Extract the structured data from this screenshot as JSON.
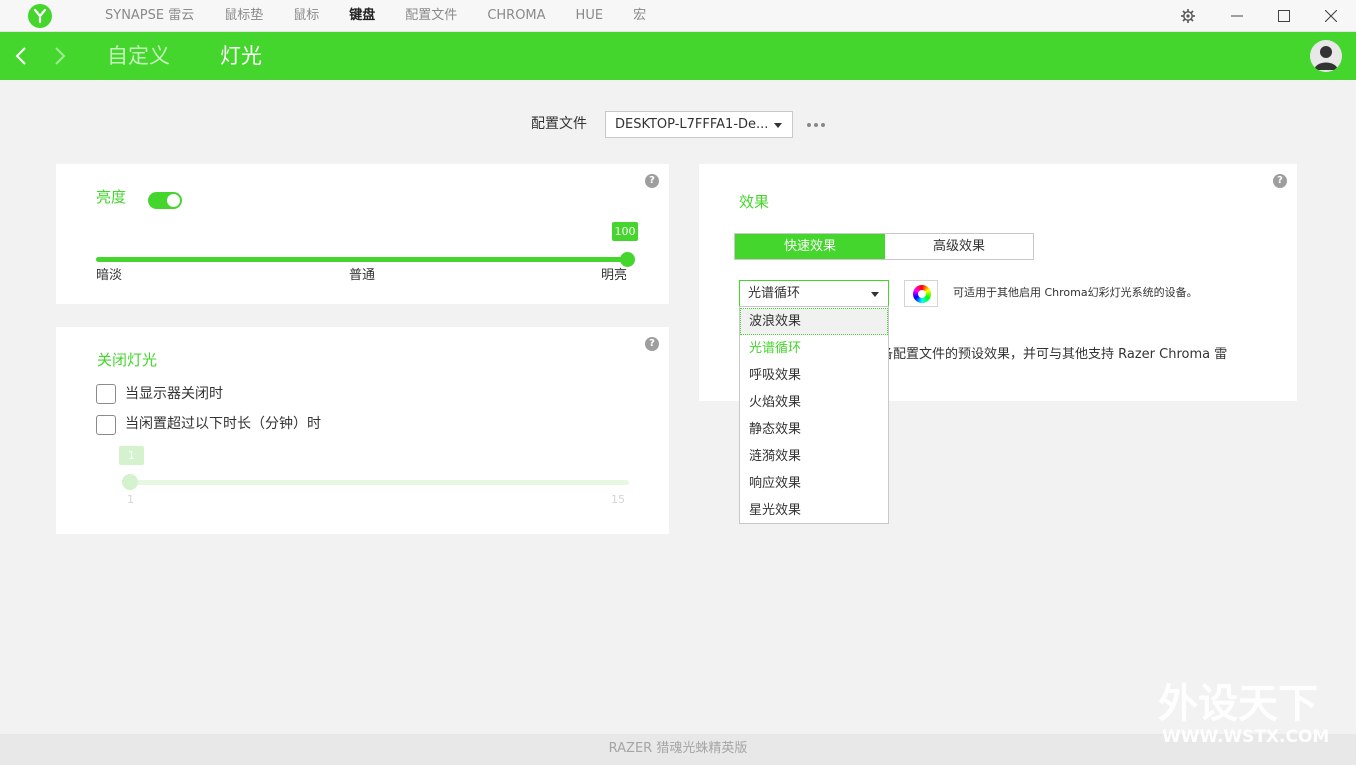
{
  "titlebar": {
    "tabs": [
      {
        "label": "SYNAPSE 雷云",
        "active": false
      },
      {
        "label": "鼠标垫",
        "active": false
      },
      {
        "label": "鼠标",
        "active": false
      },
      {
        "label": "键盘",
        "active": true
      },
      {
        "label": "配置文件",
        "active": false
      },
      {
        "label": "CHROMA",
        "active": false
      },
      {
        "label": "HUE",
        "active": false
      },
      {
        "label": "宏",
        "active": false
      }
    ]
  },
  "header": {
    "breadcrumbs": [
      "自定义",
      "灯光"
    ],
    "active_crumb": "灯光"
  },
  "profile": {
    "label": "配置文件",
    "value": "DESKTOP-L7FFFA1-De..."
  },
  "brightness": {
    "title": "亮度",
    "enabled": true,
    "value": "100",
    "level": 1.0,
    "labels": [
      "暗淡",
      "普通",
      "明亮"
    ]
  },
  "lights_off": {
    "title": "关闭灯光",
    "options": [
      {
        "label": "当显示器关闭时",
        "checked": false
      },
      {
        "label": "当闲置超过以下时长（分钟）时",
        "checked": false
      }
    ],
    "idle_value": "1",
    "idle_min": "1",
    "idle_max": "15",
    "idle_level": 0.0
  },
  "effects": {
    "title": "效果",
    "tabs": [
      {
        "label": "快速效果",
        "active": true
      },
      {
        "label": "高级效果",
        "active": false
      }
    ],
    "selected": "光谱循环",
    "note": "可适用于其他启用 Chroma幻彩灯光系统的设备。",
    "description": "备配置文件的预设效果，并可与其他支持 Razer Chroma 雷",
    "dropdown_items": [
      {
        "label": "波浪效果",
        "state": "hover"
      },
      {
        "label": "光谱循环",
        "state": "selected"
      },
      {
        "label": "呼吸效果",
        "state": ""
      },
      {
        "label": "火焰效果",
        "state": ""
      },
      {
        "label": "静态效果",
        "state": ""
      },
      {
        "label": "涟漪效果",
        "state": ""
      },
      {
        "label": "响应效果",
        "state": ""
      },
      {
        "label": "星光效果",
        "state": ""
      }
    ]
  },
  "footer": {
    "device": "RAZER 猎魂光蛛精英版"
  },
  "watermark": {
    "text": "外设天下",
    "url": "WWW.WSTX.COM"
  },
  "colors": {
    "accent": "#44d62c",
    "accent_light": "#dbf5d5",
    "background": "#f2f2f2"
  }
}
